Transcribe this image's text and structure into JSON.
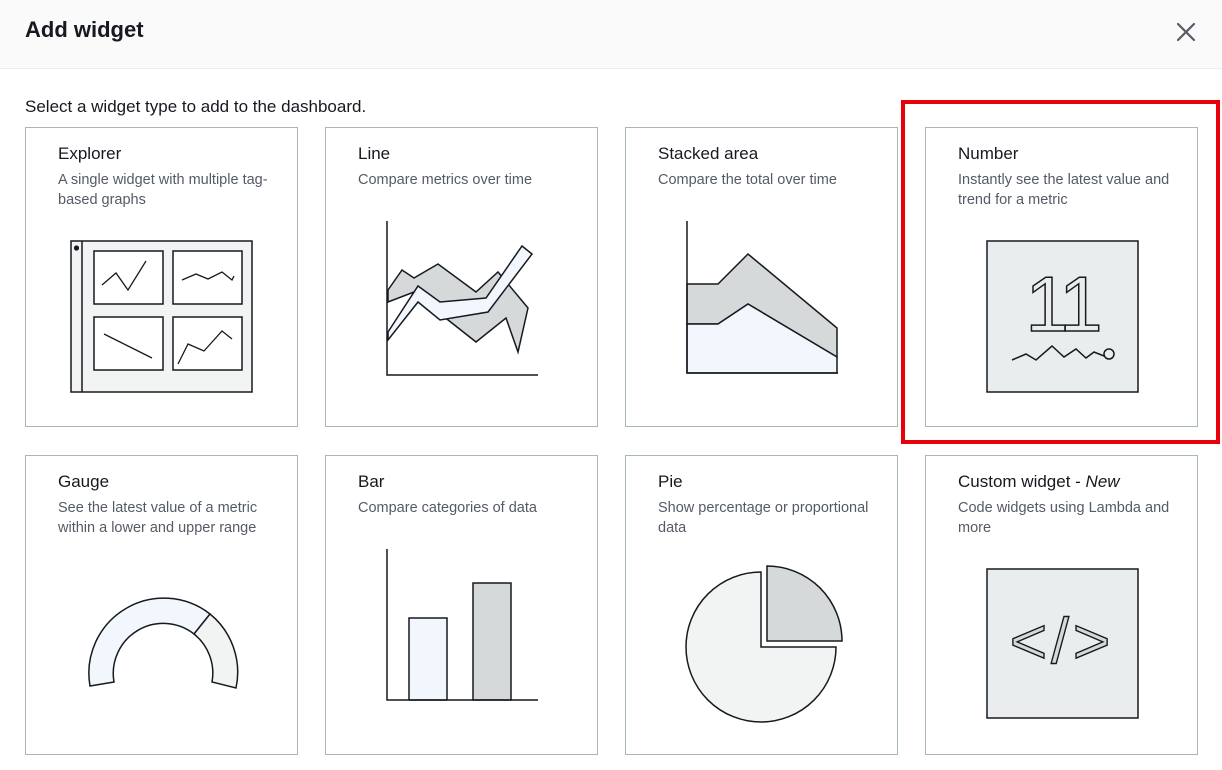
{
  "dialog": {
    "title": "Add widget",
    "close_icon": "close-icon",
    "instructions": "Select a widget type to add to the dashboard."
  },
  "widgets": [
    {
      "name": "Explorer",
      "description": "A single widget with multiple tag-based graphs",
      "icon": "explorer-illustration"
    },
    {
      "name": "Line",
      "description": "Compare metrics over time",
      "icon": "line-chart-illustration"
    },
    {
      "name": "Stacked area",
      "description": "Compare the total over time",
      "icon": "stacked-area-illustration"
    },
    {
      "name": "Number",
      "description": "Instantly see the latest value and trend for a metric",
      "icon": "number-illustration",
      "number_digits": "11",
      "highlighted": true
    },
    {
      "name": "Gauge",
      "description": "See the latest value of a metric within a lower and upper range",
      "icon": "gauge-illustration"
    },
    {
      "name": "Bar",
      "description": "Compare categories of data",
      "icon": "bar-chart-illustration"
    },
    {
      "name": "Pie",
      "description": "Show percentage or proportional data",
      "icon": "pie-chart-illustration"
    },
    {
      "name": "Custom widget - ",
      "name_suffix": "New",
      "description": "Code widgets using Lambda and more",
      "icon": "code-icon",
      "code_glyph": "</>"
    }
  ],
  "colors": {
    "highlight": "#e8000b",
    "card_border": "#aab7b8",
    "light_fill": "#f2f3f3",
    "blue_fill": "#f1f7fc",
    "gray_fill": "#d5d9d9"
  }
}
